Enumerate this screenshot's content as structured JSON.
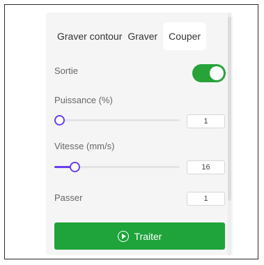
{
  "tabs": [
    {
      "label": "Graver contour",
      "active": false
    },
    {
      "label": "Graver",
      "active": false
    },
    {
      "label": "Couper",
      "active": true
    }
  ],
  "output": {
    "label": "Sortie",
    "enabled": true
  },
  "power": {
    "label": "Puissance (%)",
    "value": "1",
    "fraction": 0.0
  },
  "speed": {
    "label": "Vitesse (mm/s)",
    "value": "16",
    "fraction": 0.12
  },
  "passes": {
    "label": "Passer",
    "value": "1"
  },
  "process_button": {
    "label": "Traiter",
    "icon": "play-circle-icon"
  },
  "colors": {
    "accent": "#27a33a",
    "slider": "#6a3ff0",
    "button": "#1ea43a"
  }
}
